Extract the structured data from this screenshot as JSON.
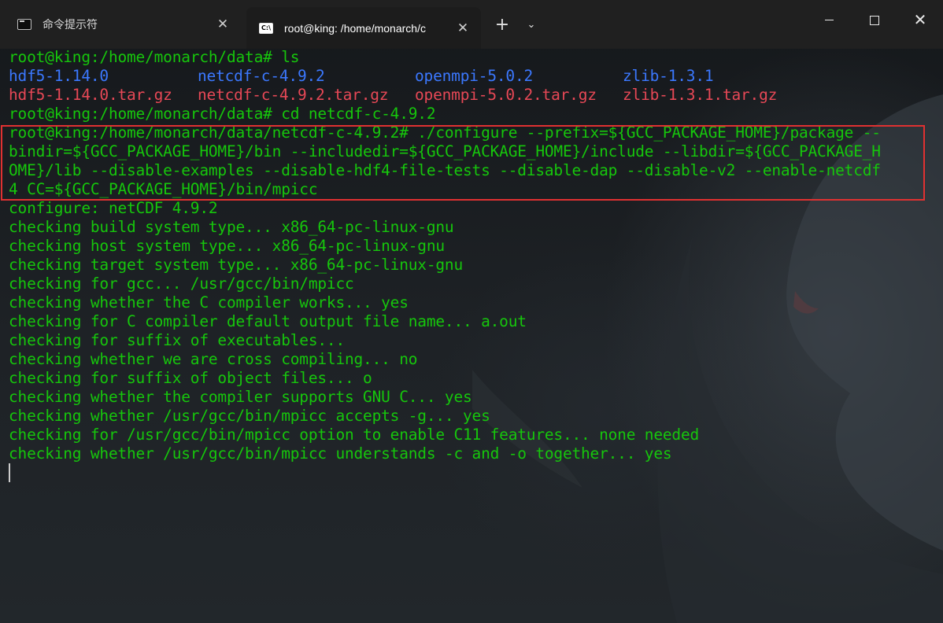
{
  "tabs": [
    {
      "label": "命令提示符",
      "close": "✕",
      "icon": "cmd-icon"
    },
    {
      "label": "root@king: /home/monarch/c",
      "close": "✕",
      "icon": "cmd-icon",
      "icon_text": "C:\\"
    }
  ],
  "new_tab": "+",
  "dropdown": "⌄",
  "window_controls": {
    "close": "✕"
  },
  "colors": {
    "prompt": "#16c60c",
    "directory": "#3b78ff",
    "archive": "#e74856",
    "highlight": "#e03131"
  },
  "terminal": {
    "l1": "root@king:/home/monarch/data# ls",
    "ls_dirs": [
      "hdf5-1.14.0",
      "netcdf-c-4.9.2",
      "openmpi-5.0.2",
      "zlib-1.3.1"
    ],
    "ls_archives": [
      "hdf5-1.14.0.tar.gz",
      "netcdf-c-4.9.2.tar.gz",
      "openmpi-5.0.2.tar.gz",
      "zlib-1.3.1.tar.gz"
    ],
    "l4": "root@king:/home/monarch/data# cd netcdf-c-4.9.2",
    "cmd": [
      "root@king:/home/monarch/data/netcdf-c-4.9.2# ./configure --prefix=${GCC_PACKAGE_HOME}/package --",
      "bindir=${GCC_PACKAGE_HOME}/bin --includedir=${GCC_PACKAGE_HOME}/include --libdir=${GCC_PACKAGE_H",
      "OME}/lib --disable-examples --disable-hdf4-file-tests --disable-dap --disable-v2 --enable-netcdf",
      "4 CC=${GCC_PACKAGE_HOME}/bin/mpicc"
    ],
    "output": [
      "configure: netCDF 4.9.2",
      "checking build system type... x86_64-pc-linux-gnu",
      "checking host system type... x86_64-pc-linux-gnu",
      "checking target system type... x86_64-pc-linux-gnu",
      "checking for gcc... /usr/gcc/bin/mpicc",
      "checking whether the C compiler works... yes",
      "checking for C compiler default output file name... a.out",
      "checking for suffix of executables...",
      "checking whether we are cross compiling... no",
      "checking for suffix of object files... o",
      "checking whether the compiler supports GNU C... yes",
      "checking whether /usr/gcc/bin/mpicc accepts -g... yes",
      "checking for /usr/gcc/bin/mpicc option to enable C11 features... none needed",
      "checking whether /usr/gcc/bin/mpicc understands -c and -o together... yes"
    ]
  }
}
